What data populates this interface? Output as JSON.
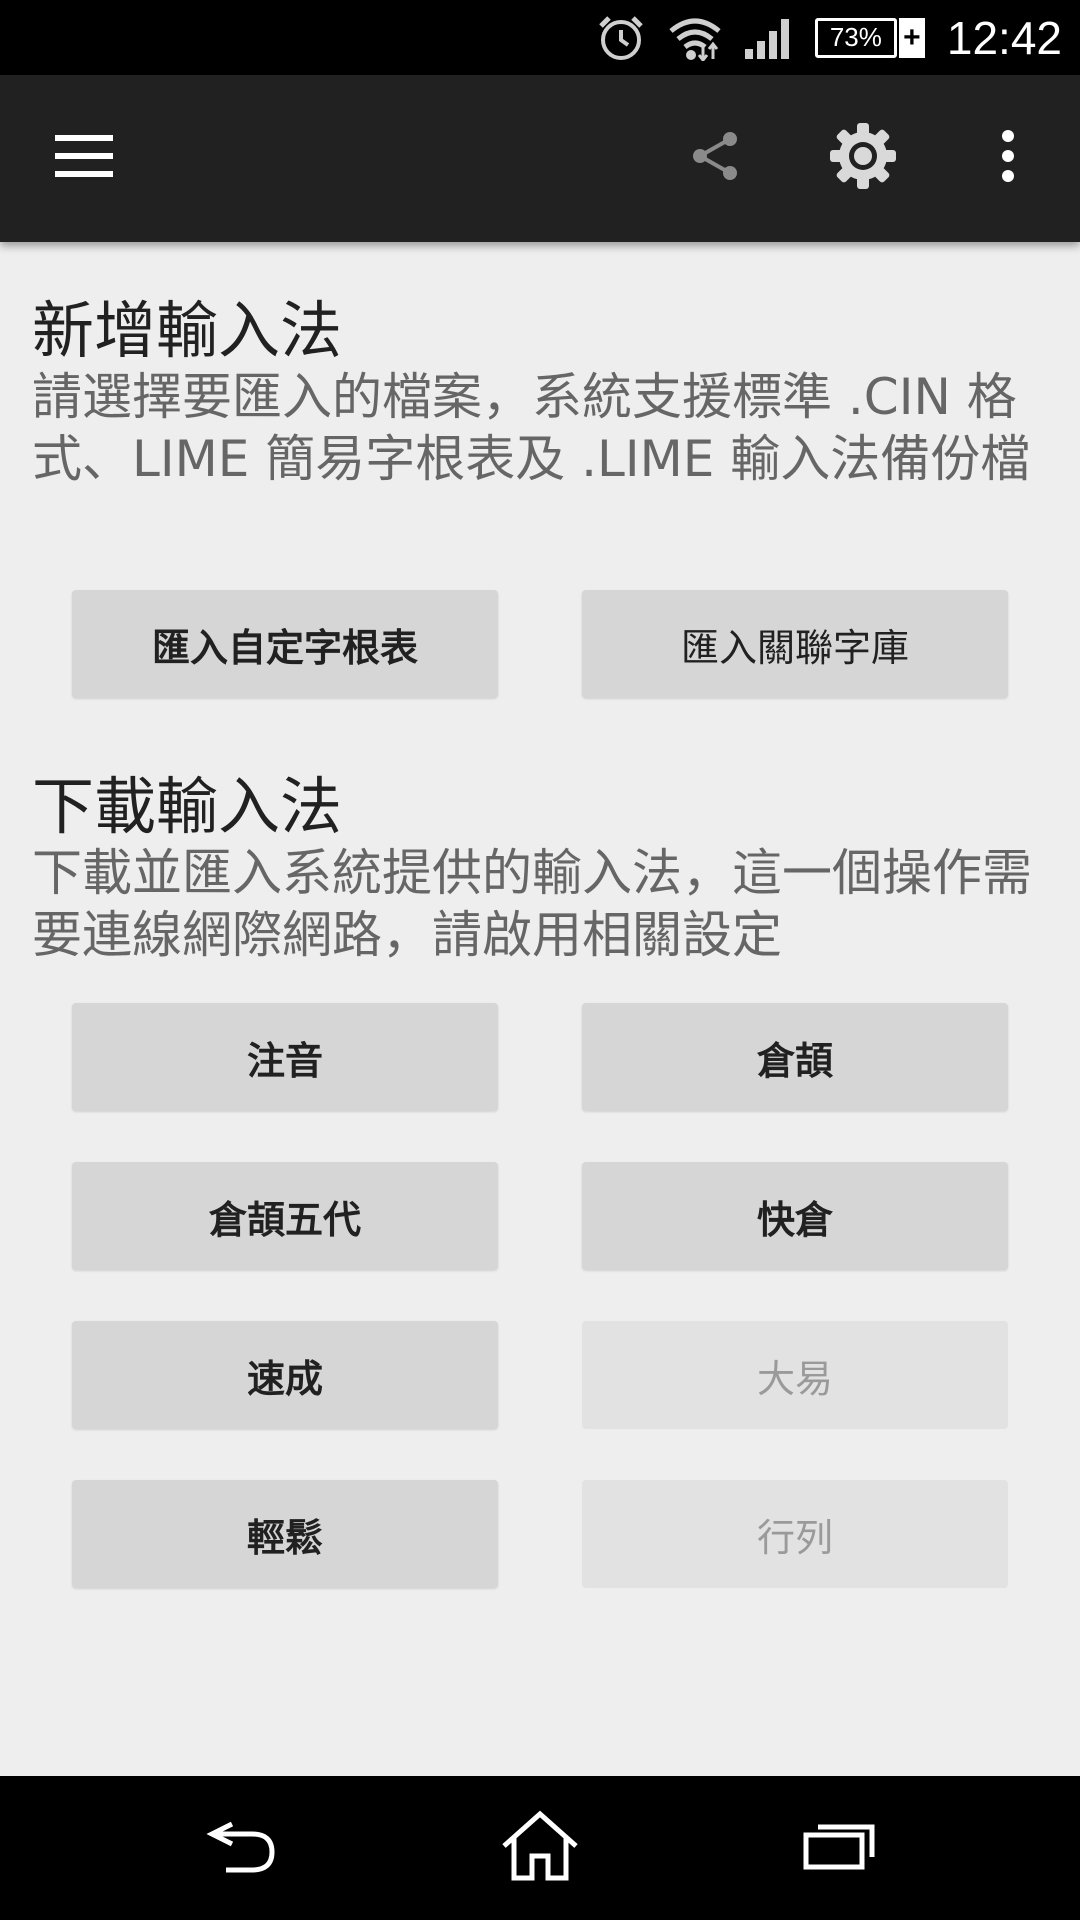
{
  "status_bar": {
    "battery_percent": "73%",
    "battery_level": 0.73,
    "battery_plus": "+",
    "time": "12:42"
  },
  "toolbar": {
    "menu_icon": "hamburger-menu-icon",
    "share_icon": "share-icon",
    "settings_icon": "gear-icon",
    "overflow_icon": "more-vertical-icon"
  },
  "import_section": {
    "title": "新增輸入法",
    "description": "請選擇要匯入的檔案，系統支援標準 .CIN 格式、LIME 簡易字根表及 .LIME 輸入法備份檔",
    "buttons": {
      "import_custom": "匯入自定字根表",
      "import_related": "匯入關聯字庫"
    }
  },
  "download_section": {
    "title": "下載輸入法",
    "description": "下載並匯入系統提供的輸入法，這一個操作需要連線網際網路，請啟用相關設定",
    "buttons": {
      "phonetic": "注音",
      "cangjie": "倉頡",
      "cangjie5": "倉頡五代",
      "quick_cangjie": "快倉",
      "speed": "速成",
      "dayi": "大易",
      "easy": "輕鬆",
      "array": "行列"
    }
  },
  "nav_bar": {
    "back_icon": "back-icon",
    "home_icon": "home-icon",
    "recents_icon": "recent-apps-icon"
  }
}
